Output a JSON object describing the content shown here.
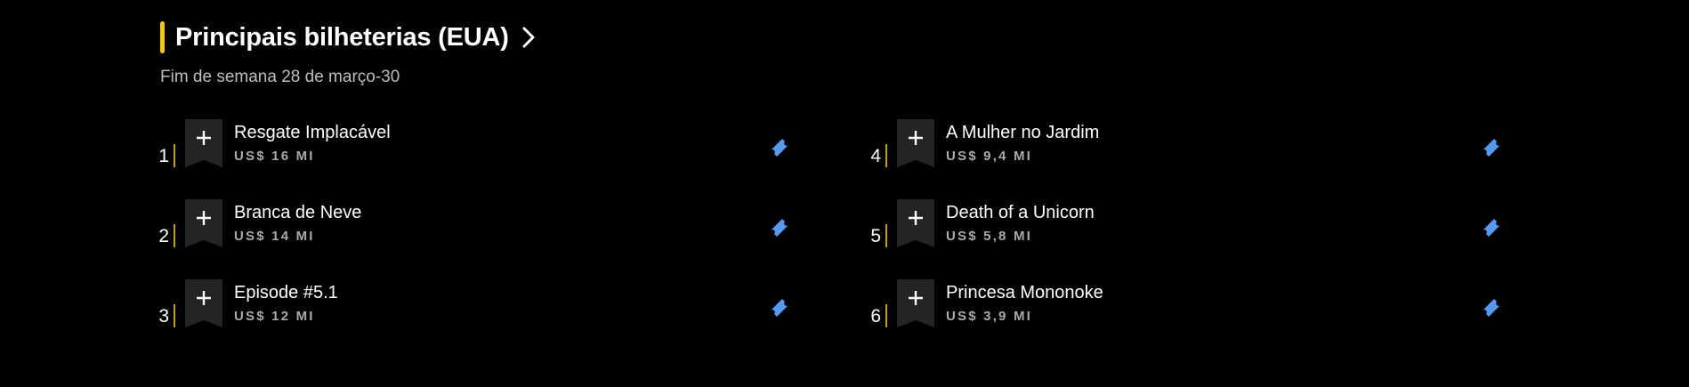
{
  "section": {
    "title": "Principais bilheterias (EUA)",
    "subtitle": "Fim de semana 28 de março-30",
    "chevron_icon": "chevron-right-icon",
    "accent_color": "#f5c518"
  },
  "items": [
    {
      "rank": "1",
      "title": "Resgate Implacável",
      "gross": "US$ 16 MI"
    },
    {
      "rank": "2",
      "title": "Branca de Neve",
      "gross": "US$ 14 MI"
    },
    {
      "rank": "3",
      "title": "Episode #5.1",
      "gross": "US$ 12 MI"
    },
    {
      "rank": "4",
      "title": "A Mulher no Jardim",
      "gross": "US$ 9,4 MI"
    },
    {
      "rank": "5",
      "title": "Death of a Unicorn",
      "gross": "US$ 5,8 MI"
    },
    {
      "rank": "6",
      "title": "Princesa Mononoke",
      "gross": "US$ 3,9 MI"
    }
  ],
  "icons": {
    "watchlist": "watchlist-add-icon",
    "ticket": "ticket-icon",
    "ticket_color": "#5799ef"
  }
}
